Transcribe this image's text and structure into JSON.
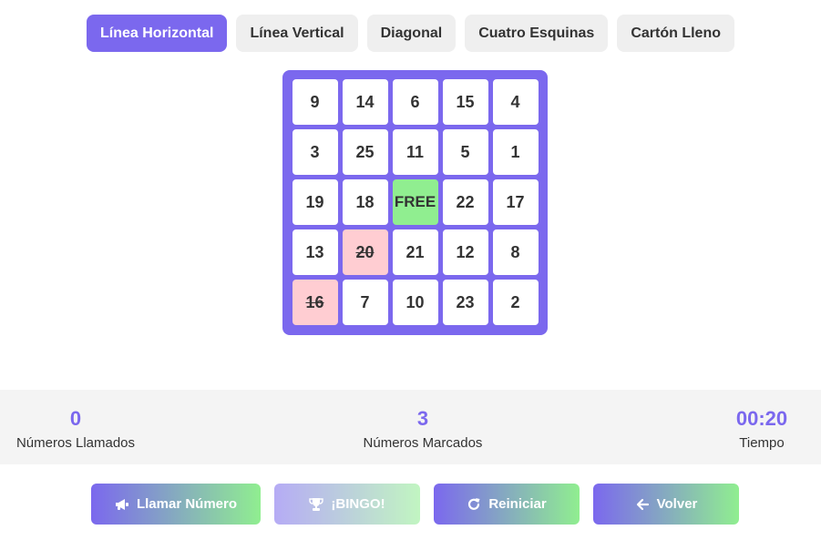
{
  "modes": [
    {
      "label": "Línea Horizontal",
      "active": true
    },
    {
      "label": "Línea Vertical",
      "active": false
    },
    {
      "label": "Diagonal",
      "active": false
    },
    {
      "label": "Cuatro Esquinas",
      "active": false
    },
    {
      "label": "Cartón Lleno",
      "active": false
    }
  ],
  "card": {
    "rows": [
      [
        "9",
        "14",
        "6",
        "15",
        "4"
      ],
      [
        "3",
        "25",
        "11",
        "5",
        "1"
      ],
      [
        "19",
        "18",
        "FREE",
        "22",
        "17"
      ],
      [
        "13",
        "20",
        "21",
        "12",
        "8"
      ],
      [
        "16",
        "7",
        "10",
        "23",
        "2"
      ]
    ],
    "marked": [
      "20",
      "16"
    ]
  },
  "stats": {
    "called": {
      "value": "0",
      "label": "Números Llamados"
    },
    "marked": {
      "value": "3",
      "label": "Números Marcados"
    },
    "time": {
      "value": "00:20",
      "label": "Tiempo"
    }
  },
  "actions": {
    "call": {
      "label": "Llamar Número",
      "icon": "megaphone-icon"
    },
    "bingo": {
      "label": "¡BINGO!",
      "icon": "trophy-icon",
      "disabled": true
    },
    "reset": {
      "label": "Reiniciar",
      "icon": "redo-icon"
    },
    "back": {
      "label": "Volver",
      "icon": "arrow-left-icon"
    }
  },
  "colors": {
    "accent": "#7b68ee",
    "free": "#90ee90",
    "marked": "#ffcdd2"
  }
}
